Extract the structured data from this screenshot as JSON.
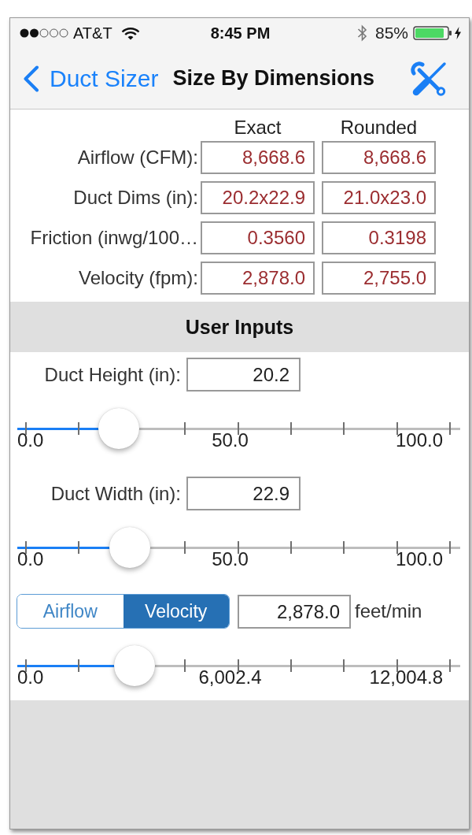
{
  "status_bar": {
    "carrier": "AT&T",
    "time": "8:45 PM",
    "battery_text": "85%"
  },
  "nav_bar": {
    "back_label": "Duct Sizer",
    "title": "Size By Dimensions"
  },
  "results": {
    "columns": [
      "Exact",
      "Rounded"
    ],
    "rows": [
      {
        "label": "Airflow (CFM):",
        "values": [
          "8,668.6",
          "8,668.6"
        ]
      },
      {
        "label": "Duct Dims (in):",
        "values": [
          "20.2x22.9",
          "21.0x23.0"
        ]
      },
      {
        "label": "Friction (inwg/100…",
        "values": [
          "0.3560",
          "0.3198"
        ]
      },
      {
        "label": "Velocity (fpm):",
        "values": [
          "2,878.0",
          "2,755.0"
        ]
      }
    ]
  },
  "user_inputs": {
    "title": "User Inputs",
    "controls": [
      {
        "kind": "labeled",
        "label": "Duct Height (in):",
        "value": "20.2",
        "slider": {
          "level": 0.202,
          "scale_labels": [
            "0.0",
            "50.0",
            "100.0"
          ]
        }
      },
      {
        "kind": "labeled",
        "label": "Duct Width (in):",
        "value": "22.9",
        "slider": {
          "level": 0.229,
          "scale_labels": [
            "0.0",
            "50.0",
            "100.0"
          ]
        }
      },
      {
        "kind": "segmented",
        "segments": [
          {
            "label": "Airflow",
            "selected": false
          },
          {
            "label": "Velocity",
            "selected": true
          }
        ],
        "value": "2,878.0",
        "unit": "feet/min",
        "slider": {
          "level": 0.24,
          "scale_labels": [
            "0.0",
            "6,002.4",
            "12,004.8"
          ]
        }
      }
    ]
  }
}
